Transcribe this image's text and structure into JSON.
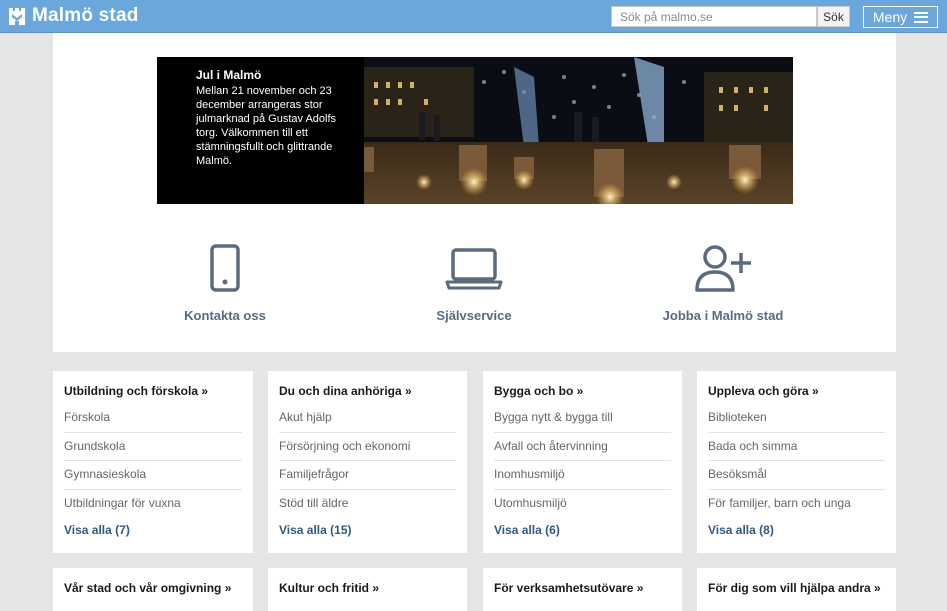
{
  "header": {
    "logo_text": "Malmö stad",
    "search_placeholder": "Sök på malmo.se",
    "search_button": "Sök",
    "menu_label": "Meny",
    "bg_color": "#6aa7dc"
  },
  "hero": {
    "title": "Jul i Malmö",
    "body": "Mellan 21 november och 23 december arrangeras stor julmarknad på Gustav Adolfs torg. Välkommen till ett stämningsfullt och glittrande Malmö."
  },
  "quick_links": [
    {
      "label": "Kontakta oss",
      "icon": "phone-icon"
    },
    {
      "label": "Självservice",
      "icon": "laptop-icon"
    },
    {
      "label": "Jobba i Malmö stad",
      "icon": "add-user-icon"
    }
  ],
  "categories": [
    {
      "title": "Utbildning och förskola »",
      "items": [
        "Förskola",
        "Grundskola",
        "Gymnasieskola",
        "Utbildningar för vuxna"
      ],
      "more": "Visa alla (7)"
    },
    {
      "title": "Du och dina anhöriga »",
      "items": [
        "Akut hjälp",
        "Försörjning och ekonomi",
        "Familjefrågor",
        "Stöd till äldre"
      ],
      "more": "Visa alla (15)"
    },
    {
      "title": "Bygga och bo »",
      "items": [
        "Bygga nytt & bygga till",
        "Avfall och återvinning",
        "Inomhusmiljö",
        "Utomhusmiljö"
      ],
      "more": "Visa alla (6)"
    },
    {
      "title": "Uppleva och göra »",
      "items": [
        "Biblioteken",
        "Bada och simma",
        "Besöksmål",
        "För familjer, barn och unga"
      ],
      "more": "Visa alla (8)"
    },
    {
      "title": "Vår stad och vår omgivning »"
    },
    {
      "title": "Kultur och fritid »"
    },
    {
      "title": "För verksamhetsutövare »"
    },
    {
      "title": "För dig som vill hjälpa andra »"
    }
  ],
  "colors": {
    "accent": "#6aa7dc",
    "link": "#2f5a86",
    "icon": "#5a6b80"
  }
}
